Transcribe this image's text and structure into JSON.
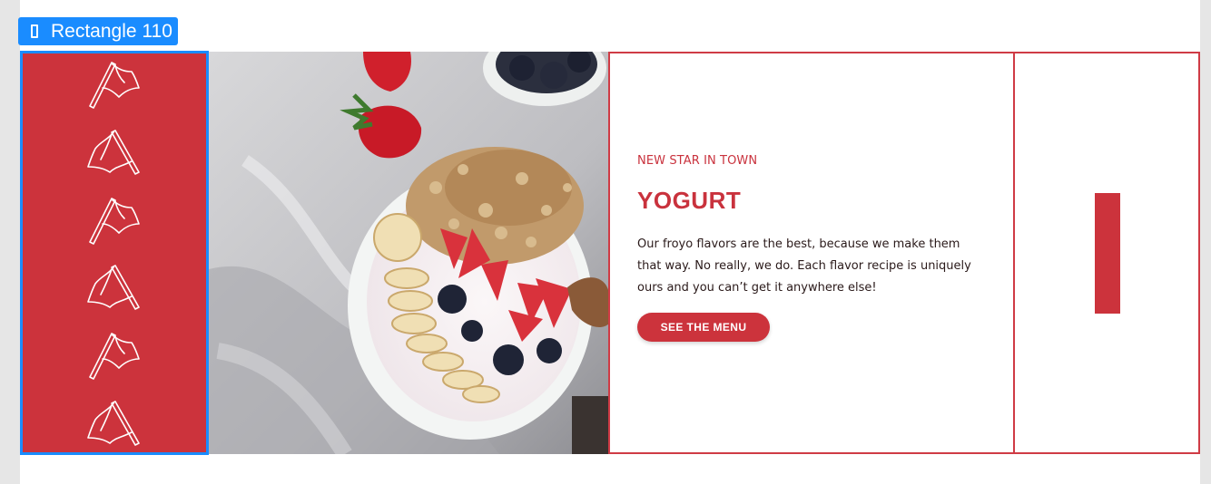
{
  "selection": {
    "layer_name": "Rectangle 110",
    "icon": "frame-icon",
    "color": "#1a8cff"
  },
  "flags": {
    "count": 6,
    "icon": "flag-icon",
    "panel_color": "#cc333c"
  },
  "photo": {
    "subject": "yogurt bowl with granola, strawberries, banana and blueberries"
  },
  "hero": {
    "eyebrow": "NEW STAR IN TOWN",
    "title": "YOGURT",
    "body": "Our froyo flavors are the best, because we make them that way. No really, we do. Each flavor recipe is uniquely ours and you can’t get it anywhere else!",
    "cta_label": "SEE THE MENU"
  },
  "colors": {
    "brand_red": "#cc333c",
    "border_red": "#cf3b45",
    "selection_blue": "#1a8cff"
  }
}
